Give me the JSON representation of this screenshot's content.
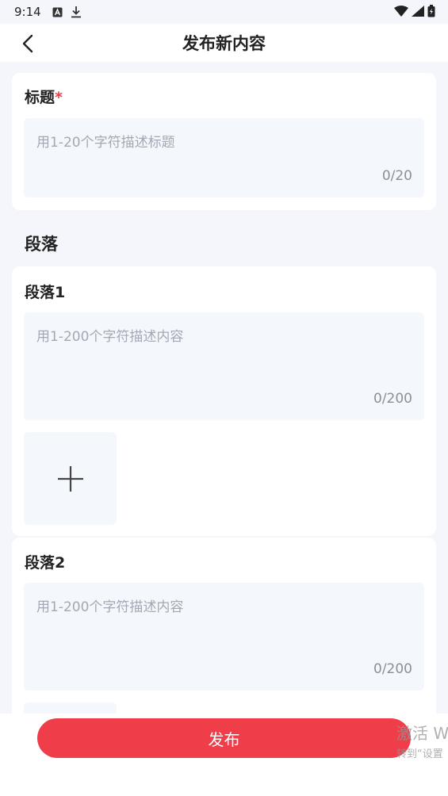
{
  "status_bar": {
    "time": "9:14"
  },
  "header": {
    "title": "发布新内容"
  },
  "title_card": {
    "label": "标题",
    "required_mark": "*",
    "placeholder": "用1-20个字符描述标题",
    "counter": "0/20"
  },
  "section": {
    "title": "段落"
  },
  "paragraphs": [
    {
      "label": "段落1",
      "placeholder": "用1-200个字符描述内容",
      "counter": "0/200"
    },
    {
      "label": "段落2",
      "placeholder": "用1-200个字符描述内容",
      "counter": "0/200"
    }
  ],
  "footer": {
    "publish_label": "发布"
  },
  "watermark": {
    "line1": "激活 W",
    "line2": "转到“设置"
  },
  "colors": {
    "accent": "#ef3e4a",
    "background": "#f4f6fb",
    "input_bg": "#f4f7fc"
  }
}
